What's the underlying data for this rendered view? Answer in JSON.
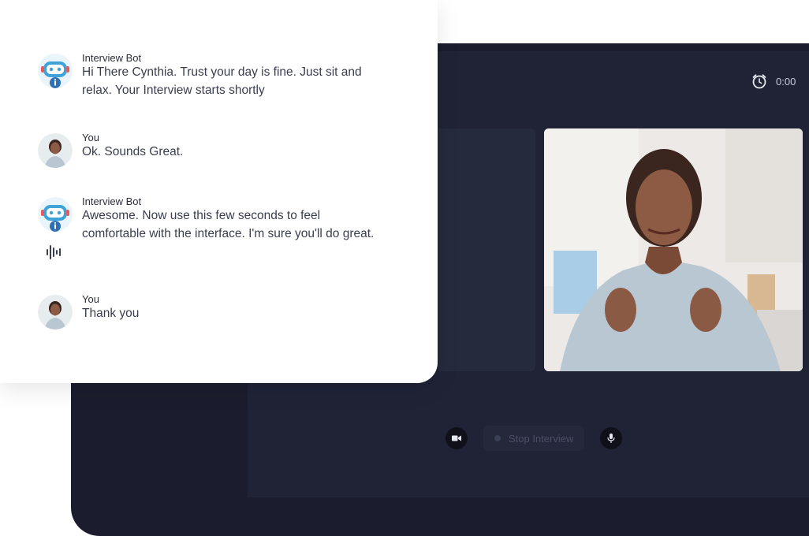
{
  "chat": {
    "messages": [
      {
        "sender": "Interview Bot",
        "text": "Hi There Cynthia. Trust your day is fine. Just sit and relax. Your Interview starts shortly",
        "avatar": "robot-avatar"
      },
      {
        "sender": "You",
        "text": "Ok. Sounds Great.",
        "avatar": "user-avatar"
      },
      {
        "sender": "Interview Bot",
        "text": "Awesome. Now use this few seconds to feel comfortable with the interface. I'm sure you'll do great.",
        "avatar": "robot-avatar"
      },
      {
        "sender": "You",
        "text": "Thank you",
        "avatar": "user-avatar"
      }
    ]
  },
  "header": {
    "timer": "0:00",
    "timer_icon": "alarm-clock-icon"
  },
  "controls": {
    "stop_label": "Stop Interview",
    "camera_icon": "video-camera-icon",
    "mic_icon": "microphone-icon"
  },
  "colors": {
    "window_bg": "#1b1d2e",
    "panel_bg": "#202336",
    "bot_blue": "#3fa3d9",
    "card_bg": "#ffffff"
  }
}
